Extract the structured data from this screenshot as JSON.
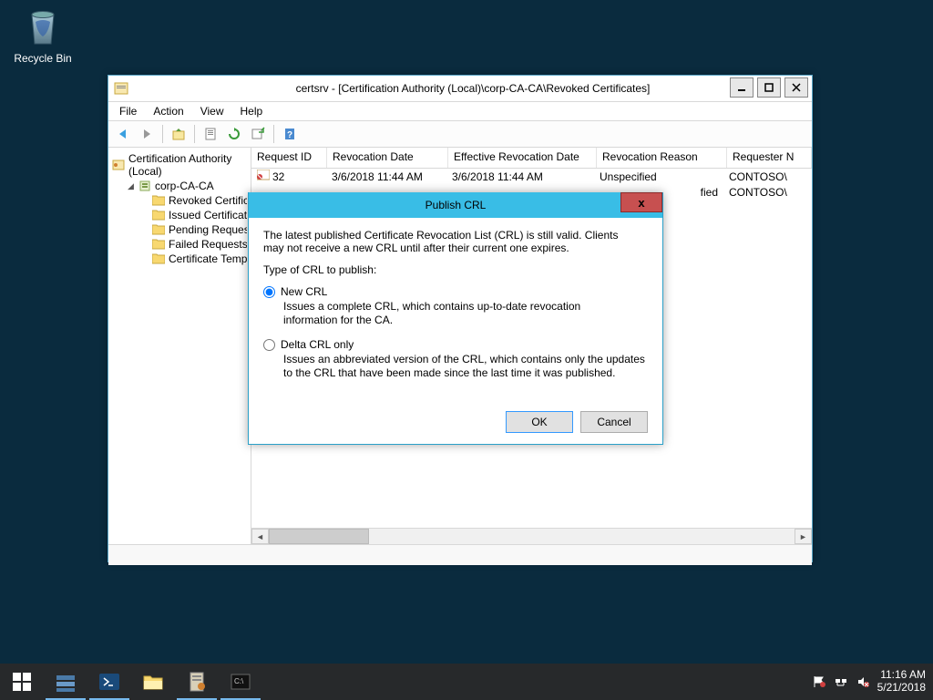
{
  "desktop": {
    "recycle_bin": "Recycle Bin"
  },
  "window": {
    "title": "certsrv - [Certification Authority (Local)\\corp-CA-CA\\Revoked Certificates]",
    "menu": {
      "file": "File",
      "action": "Action",
      "view": "View",
      "help": "Help"
    },
    "tree": {
      "root": "Certification Authority (Local)",
      "ca": "corp-CA-CA",
      "items": [
        "Revoked Certificates",
        "Issued Certificates",
        "Pending Requests",
        "Failed Requests",
        "Certificate Templates"
      ]
    },
    "columns": [
      "Request ID",
      "Revocation Date",
      "Effective Revocation Date",
      "Revocation Reason",
      "Requester Name"
    ],
    "rows": [
      {
        "id": "32",
        "rev": "3/6/2018 11:44 AM",
        "eff": "3/6/2018 11:44 AM",
        "reason": "Unspecified",
        "req": "CONTOSO\\"
      },
      {
        "id": "",
        "rev": "",
        "eff": "",
        "reason": "fied",
        "req": "CONTOSO\\"
      }
    ]
  },
  "dialog": {
    "title": "Publish CRL",
    "intro": "The latest published Certificate Revocation List (CRL) is still valid. Clients may not receive a new CRL until after their current one expires.",
    "type_label": "Type of CRL to publish:",
    "opt1": {
      "label": "New CRL",
      "desc": "Issues a complete CRL, which contains up-to-date revocation information for the CA."
    },
    "opt2": {
      "label": "Delta CRL only",
      "desc": "Issues an abbreviated version of the CRL, which contains only the updates to the CRL that have been made since the last time it was published."
    },
    "ok": "OK",
    "cancel": "Cancel"
  },
  "taskbar": {
    "time": "11:16 AM",
    "date": "5/21/2018"
  }
}
